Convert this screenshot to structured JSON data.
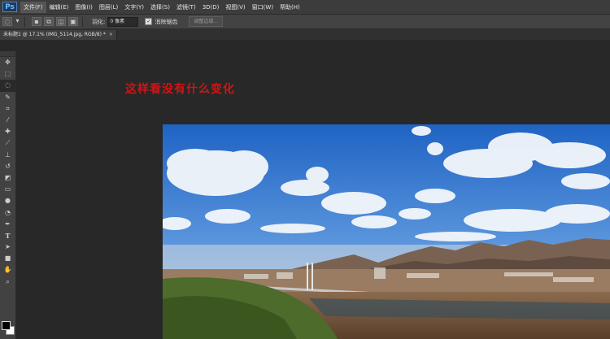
{
  "app": {
    "logo": "Ps"
  },
  "menu": [
    {
      "label": "文件(F)",
      "active": true
    },
    {
      "label": "编辑(E)"
    },
    {
      "label": "图像(I)"
    },
    {
      "label": "图层(L)"
    },
    {
      "label": "文字(Y)"
    },
    {
      "label": "选择(S)"
    },
    {
      "label": "滤镜(T)"
    },
    {
      "label": "3D(D)"
    },
    {
      "label": "视图(V)"
    },
    {
      "label": "窗口(W)"
    },
    {
      "label": "帮助(H)"
    }
  ],
  "options": {
    "feather_label": "羽化:",
    "feather_value": "0 像素",
    "antialias_label": "消除锯齿",
    "antialias_checked": true,
    "refine_edge_label": "调整边缘..."
  },
  "document_tab": {
    "title": "未标题1 @ 17.1% (IMG_5114.jpg, RGB/8) *",
    "close": "×"
  },
  "annotation": "这样看没有什么变化",
  "tools": [
    "move-tool-icon",
    "marquee-tool-icon",
    "lasso-tool-icon",
    "quick-selection-tool-icon",
    "crop-tool-icon",
    "eyedropper-tool-icon",
    "spot-healing-tool-icon",
    "brush-tool-icon",
    "clone-stamp-tool-icon",
    "history-brush-tool-icon",
    "eraser-tool-icon",
    "gradient-tool-icon",
    "blur-tool-icon",
    "dodge-tool-icon",
    "pen-tool-icon",
    "type-tool-icon",
    "path-selection-tool-icon",
    "rectangle-tool-icon",
    "hand-tool-icon",
    "zoom-tool-icon"
  ],
  "colors": {
    "foreground": "#000000",
    "background": "#ffffff",
    "annotation": "#d21414"
  }
}
